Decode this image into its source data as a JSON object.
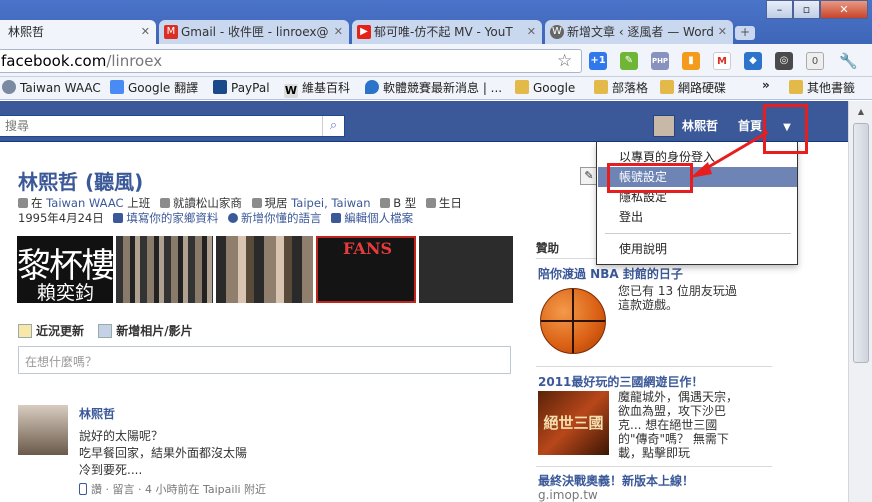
{
  "browser": {
    "tabs": [
      {
        "title": "林熙哲"
      },
      {
        "title": "Gmail - 收件匣 - linroex@"
      },
      {
        "title": "郁可唯-仿不起 MV - YouT"
      },
      {
        "title": "新增文章 ‹ 逐風者 — Word"
      }
    ],
    "url_host": "facebook.com",
    "url_path": "/linroex",
    "extensions": [
      "+1",
      "PHP",
      "0"
    ],
    "bookmarks": [
      "Taiwan WAAC",
      "Google 翻譯",
      "PayPal",
      "維基百科",
      "軟體競賽最新消息 | ...",
      "Google",
      "部落格",
      "網路硬碟",
      "其他書籤"
    ],
    "overflow": "»"
  },
  "fb": {
    "search_placeholder": "搜尋",
    "user_name": "林熙哲",
    "home": "首頁"
  },
  "menu": {
    "items": [
      "以專頁的身份登入",
      "帳號設定",
      "隱私設定",
      "登出",
      "使用說明"
    ],
    "highlighted": "帳號設定"
  },
  "profile": {
    "name": "林熙哲 (聽風)",
    "line1": {
      "work_prefix": "在",
      "work_link": "Taiwan WAAC",
      "work_suffix": "上班",
      "school": "就讀松山家商",
      "live_prefix": "現居",
      "live_link": "Taipei, Taiwan",
      "blood": "B 型",
      "birthday_label": "生日"
    },
    "line2": {
      "birthday": "1995年4月24日",
      "hometown": "填寫你的家鄉資料",
      "language": "新增你懂的語言",
      "edit": "編輯個人檔案"
    },
    "photo_text": [
      "黎杯樓",
      "賴奕鈞",
      "FANS"
    ],
    "tabs": [
      "近況更新",
      "新增相片/影片"
    ],
    "status_placeholder": "在想什麼嗎？"
  },
  "post": {
    "author": "林熙哲",
    "lines": [
      "說好的太陽呢？",
      "吃早餐回家，結果外面都沒太陽",
      "冷到要死...."
    ],
    "meta": "讚 · 留言 · 4 小時前在 Taipaili 附近"
  },
  "sidebar": {
    "sponsored": "贊助",
    "ad1": {
      "title": "陪你渡過 NBA 封館的日子",
      "text": [
        "您已有 13 位朋友玩過",
        "這款遊戲。"
      ]
    },
    "ad2": {
      "title": "2011最好玩的三國網遊巨作！",
      "text": [
        "魔龍城外，偶遇天宗，",
        "欲血為盟，攻下沙巴",
        "克... 想在絕世三國",
        "的\"傳奇\"嗎？ 無需下",
        "載，點擊即玩"
      ],
      "image_text": "絕世三國"
    },
    "ad3": {
      "title": "最終決戰奧義！新版本上線！",
      "url": "g.imop.tw"
    }
  },
  "colors": {
    "fb_blue": "#3b5998",
    "highlight": "#6d84b4",
    "annotation_red": "#e81d1d"
  }
}
